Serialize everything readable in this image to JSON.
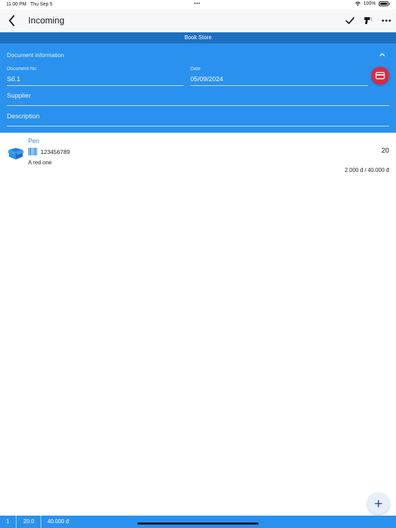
{
  "status_bar": {
    "time": "11:00 PM",
    "date": "Thu Sep 5",
    "battery": "100%"
  },
  "nav": {
    "title": "Incoming"
  },
  "store": {
    "name": "Book Store"
  },
  "document": {
    "header": "Document information",
    "doc_no_label": "Document No",
    "doc_no_value": "Số.1",
    "date_label": "Date",
    "date_value": "05/09/2024",
    "supplier_placeholder": "Supplier",
    "description_placeholder": "Description"
  },
  "items": [
    {
      "name": "Pen",
      "barcode": "123456789",
      "description": "A red one",
      "quantity": "20",
      "price": "2.000 đ / 40.000 đ"
    }
  ],
  "footer": {
    "count": "1",
    "total_qty": "20.0",
    "total_amount": "40.000 đ"
  },
  "colors": {
    "accent": "#2a91ee",
    "store_bar": "#1f6fc0",
    "danger": "#e0283e"
  }
}
